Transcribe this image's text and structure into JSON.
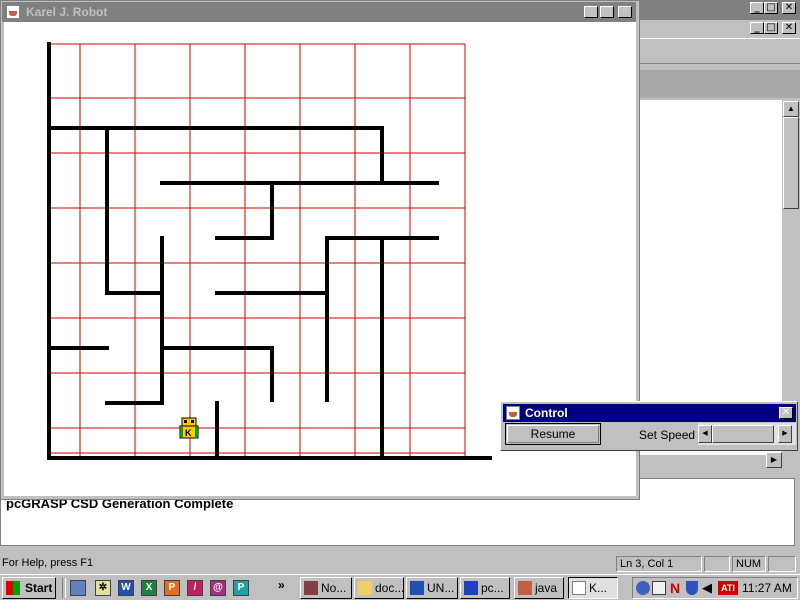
{
  "karel_window": {
    "title": "Karel J. Robot",
    "buttons": {
      "minimize": "_",
      "maximize": "□",
      "close": "✕"
    },
    "robot_label": "K"
  },
  "maze": {
    "grid_color": "#d00000",
    "wall_color": "#000000",
    "avenues": 8,
    "streets": 8
  },
  "background_app": {
    "output_text": "pcGRASP CSD Generation Complete",
    "scroll_up": "▲"
  },
  "control_dialog": {
    "title": "Control",
    "close": "✕",
    "resume_label": "Resume",
    "speed_label": "Set Speed",
    "left_arrow": "◀",
    "right_arrow": "▶"
  },
  "status_bar": {
    "help_text": "For Help, press F1",
    "position": "Ln 3, Col 1",
    "num": "NUM"
  },
  "taskbar": {
    "start_label": "Start",
    "chevron": "»",
    "tasks": [
      {
        "label": "No...",
        "icon": "notepad-icon"
      },
      {
        "label": "doc...",
        "icon": "folder-icon"
      },
      {
        "label": "UN...",
        "icon": "word-icon"
      },
      {
        "label": "pc...",
        "icon": "grasp-icon"
      },
      {
        "label": "java",
        "icon": "java-icon"
      },
      {
        "label": "K...",
        "icon": "java-icon"
      }
    ],
    "tray_letters": [
      "N",
      "ATI"
    ],
    "clock": "11:27 AM"
  },
  "colors": {
    "active_title": "#000080",
    "inactive_title": "#808080",
    "desktop": "#c0c0c0"
  }
}
